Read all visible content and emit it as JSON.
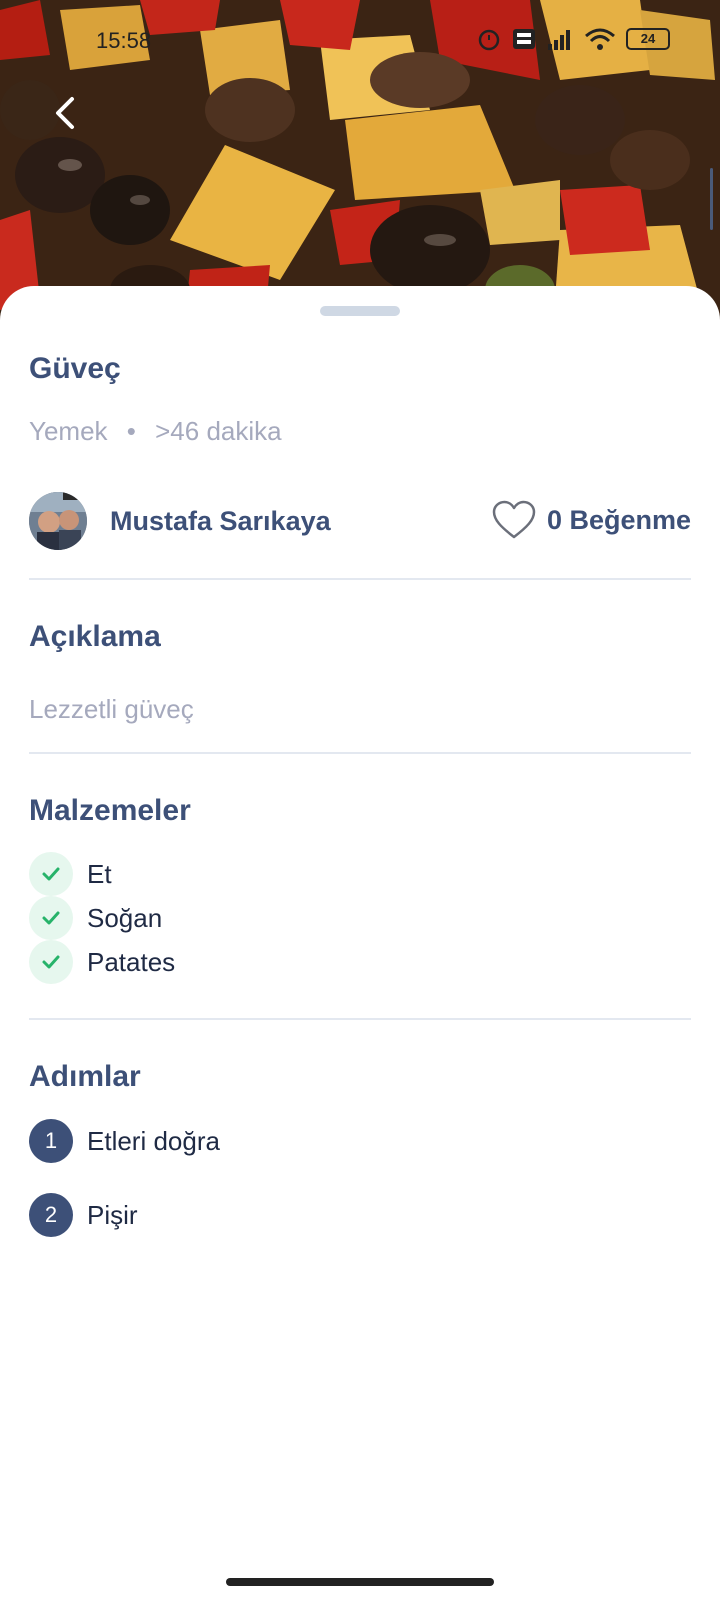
{
  "status_bar": {
    "time": "15:58",
    "battery": "24"
  },
  "recipe": {
    "title": "Güveç",
    "category": "Yemek",
    "separator": "•",
    "duration": ">46 dakika",
    "author": "Mustafa Sarıkaya",
    "likes_label": "0 Beğenme"
  },
  "description": {
    "heading": "Açıklama",
    "text": "Lezzetli güveç"
  },
  "ingredients": {
    "heading": "Malzemeler",
    "items": [
      "Et",
      "Soğan",
      "Patates"
    ]
  },
  "steps": {
    "heading": "Adımlar",
    "items": [
      {
        "number": "1",
        "text": "Etleri doğra"
      },
      {
        "number": "2",
        "text": "Pişir"
      }
    ]
  },
  "colors": {
    "primary": "#3d5078",
    "muted": "#a5a9bd",
    "check_bg": "#e6f7ee",
    "check": "#27b36a"
  },
  "icons": {
    "back": "chevron-left-icon",
    "like": "heart-outline-icon",
    "check": "check-icon"
  }
}
